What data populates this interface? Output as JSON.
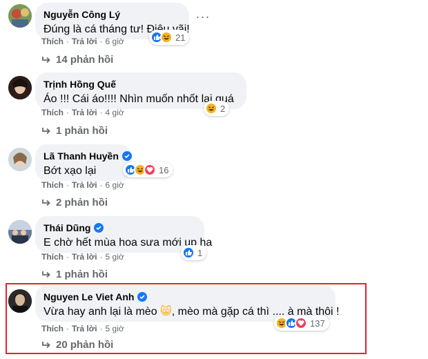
{
  "comments": [
    {
      "author": "Nguyễn Công Lý",
      "verified": false,
      "text": "Đúng là cá tháng tư! Điêu vãi!",
      "reactions": [
        "like",
        "haha"
      ],
      "reaction_count": "21",
      "like_label": "Thích",
      "reply_label": "Trả lời",
      "time": "6 giờ",
      "replies": "14 phản hồi"
    },
    {
      "author": "Trịnh Hồng Quế",
      "verified": false,
      "text": "Áo !!! Cái áo!!!! Nhìn muốn nhốt lại quá",
      "reactions": [
        "haha"
      ],
      "reaction_count": "2",
      "like_label": "Thích",
      "reply_label": "Trả lời",
      "time": "4 giờ",
      "replies": "1 phản hồi"
    },
    {
      "author": "Lã Thanh Huyền",
      "verified": true,
      "text": "Bớt xạo lại",
      "reactions": [
        "like",
        "haha",
        "love"
      ],
      "reaction_count": "16",
      "like_label": "Thích",
      "reply_label": "Trả lời",
      "time": "6 giờ",
      "replies": "2 phản hồi"
    },
    {
      "author": "Thái Dũng",
      "verified": true,
      "text": "E chờ hết mùa hoa sưa mới up ha",
      "reactions": [
        "like"
      ],
      "reaction_count": "1",
      "like_label": "Thích",
      "reply_label": "Trả lời",
      "time": "5 giờ",
      "replies": "1 phản hồi"
    },
    {
      "author": "Nguyen Le Viet Anh",
      "verified": true,
      "text_before": "Vừa hay anh lại là mèo ",
      "emoji": "😸",
      "text_after": ", mèo mà gặp cá thì .... à mà thôi !",
      "reactions": [
        "haha",
        "like",
        "love"
      ],
      "reaction_count": "137",
      "like_label": "Thích",
      "reply_label": "Trả lời",
      "time": "5 giờ",
      "replies": "20 phản hồi",
      "highlighted": true
    }
  ],
  "colors": {
    "bubble": "#f0f2f5",
    "meta_text": "#65676b",
    "verified": "#1877f2",
    "highlight_border": "#e8202a"
  },
  "icons": {
    "more": "more-options-icon",
    "reply_arrow": "reply-arrow-icon",
    "verified": "verified-badge-icon",
    "like": "like-reaction-icon",
    "haha": "haha-reaction-icon",
    "love": "love-reaction-icon"
  }
}
